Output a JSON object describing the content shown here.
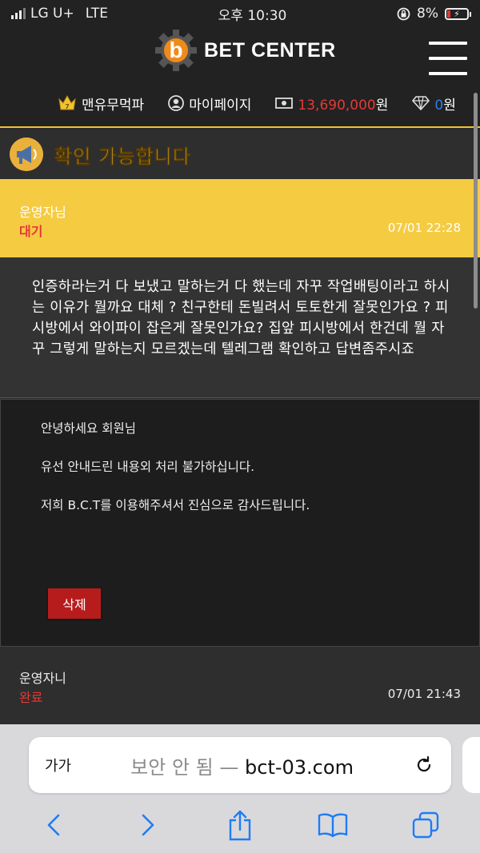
{
  "status_bar": {
    "carrier": "LG U+",
    "network": "LTE",
    "time": "오후 10:30",
    "battery_percent": "8%"
  },
  "header": {
    "logo_letter": "b",
    "logo_text": "BET CENTER"
  },
  "nav": {
    "user_name": "맨유무먹파",
    "mypage_label": "마이페이지",
    "balance": "13,690,000",
    "balance_unit": "원",
    "points": "0",
    "points_unit": "원"
  },
  "notice": {
    "text": "확인 가능합니다"
  },
  "inquiry_1": {
    "author": "운영자님",
    "status": "대기",
    "date": "07/01 22:28",
    "body": "인증하라는거 다 보냈고 말하는거 다 했는데 자꾸 작업배팅이라고 하시는 이유가 뭘까요 대체 ? 친구한테 돈빌려서 토토한게 잘못인가요 ? 피시방에서 와이파이 잡은게 잘못인가요? 집앞 피시방에서 한건데 뭘 자꾸 그렇게 말하는지 모르겠는데 텔레그램 확인하고 답변좀주시죠"
  },
  "answer": {
    "greeting": "안녕하세요 회원님",
    "line2": "유선 안내드린 내용외 처리 불가하십니다.",
    "line3": "저희 B.C.T를 이용해주셔서 진심으로 감사드립니다.",
    "delete_label": "삭제"
  },
  "inquiry_2": {
    "author": "운영자니",
    "status": "완료",
    "date": "07/01 21:43"
  },
  "safari": {
    "text_size_label": "가가",
    "insecure_label": "보안 안 됨 —",
    "domain": "bct-03.com"
  },
  "colors": {
    "accent_yellow": "#f5cb42",
    "status_red": "#e53935",
    "points_blue": "#2f7ce8"
  }
}
